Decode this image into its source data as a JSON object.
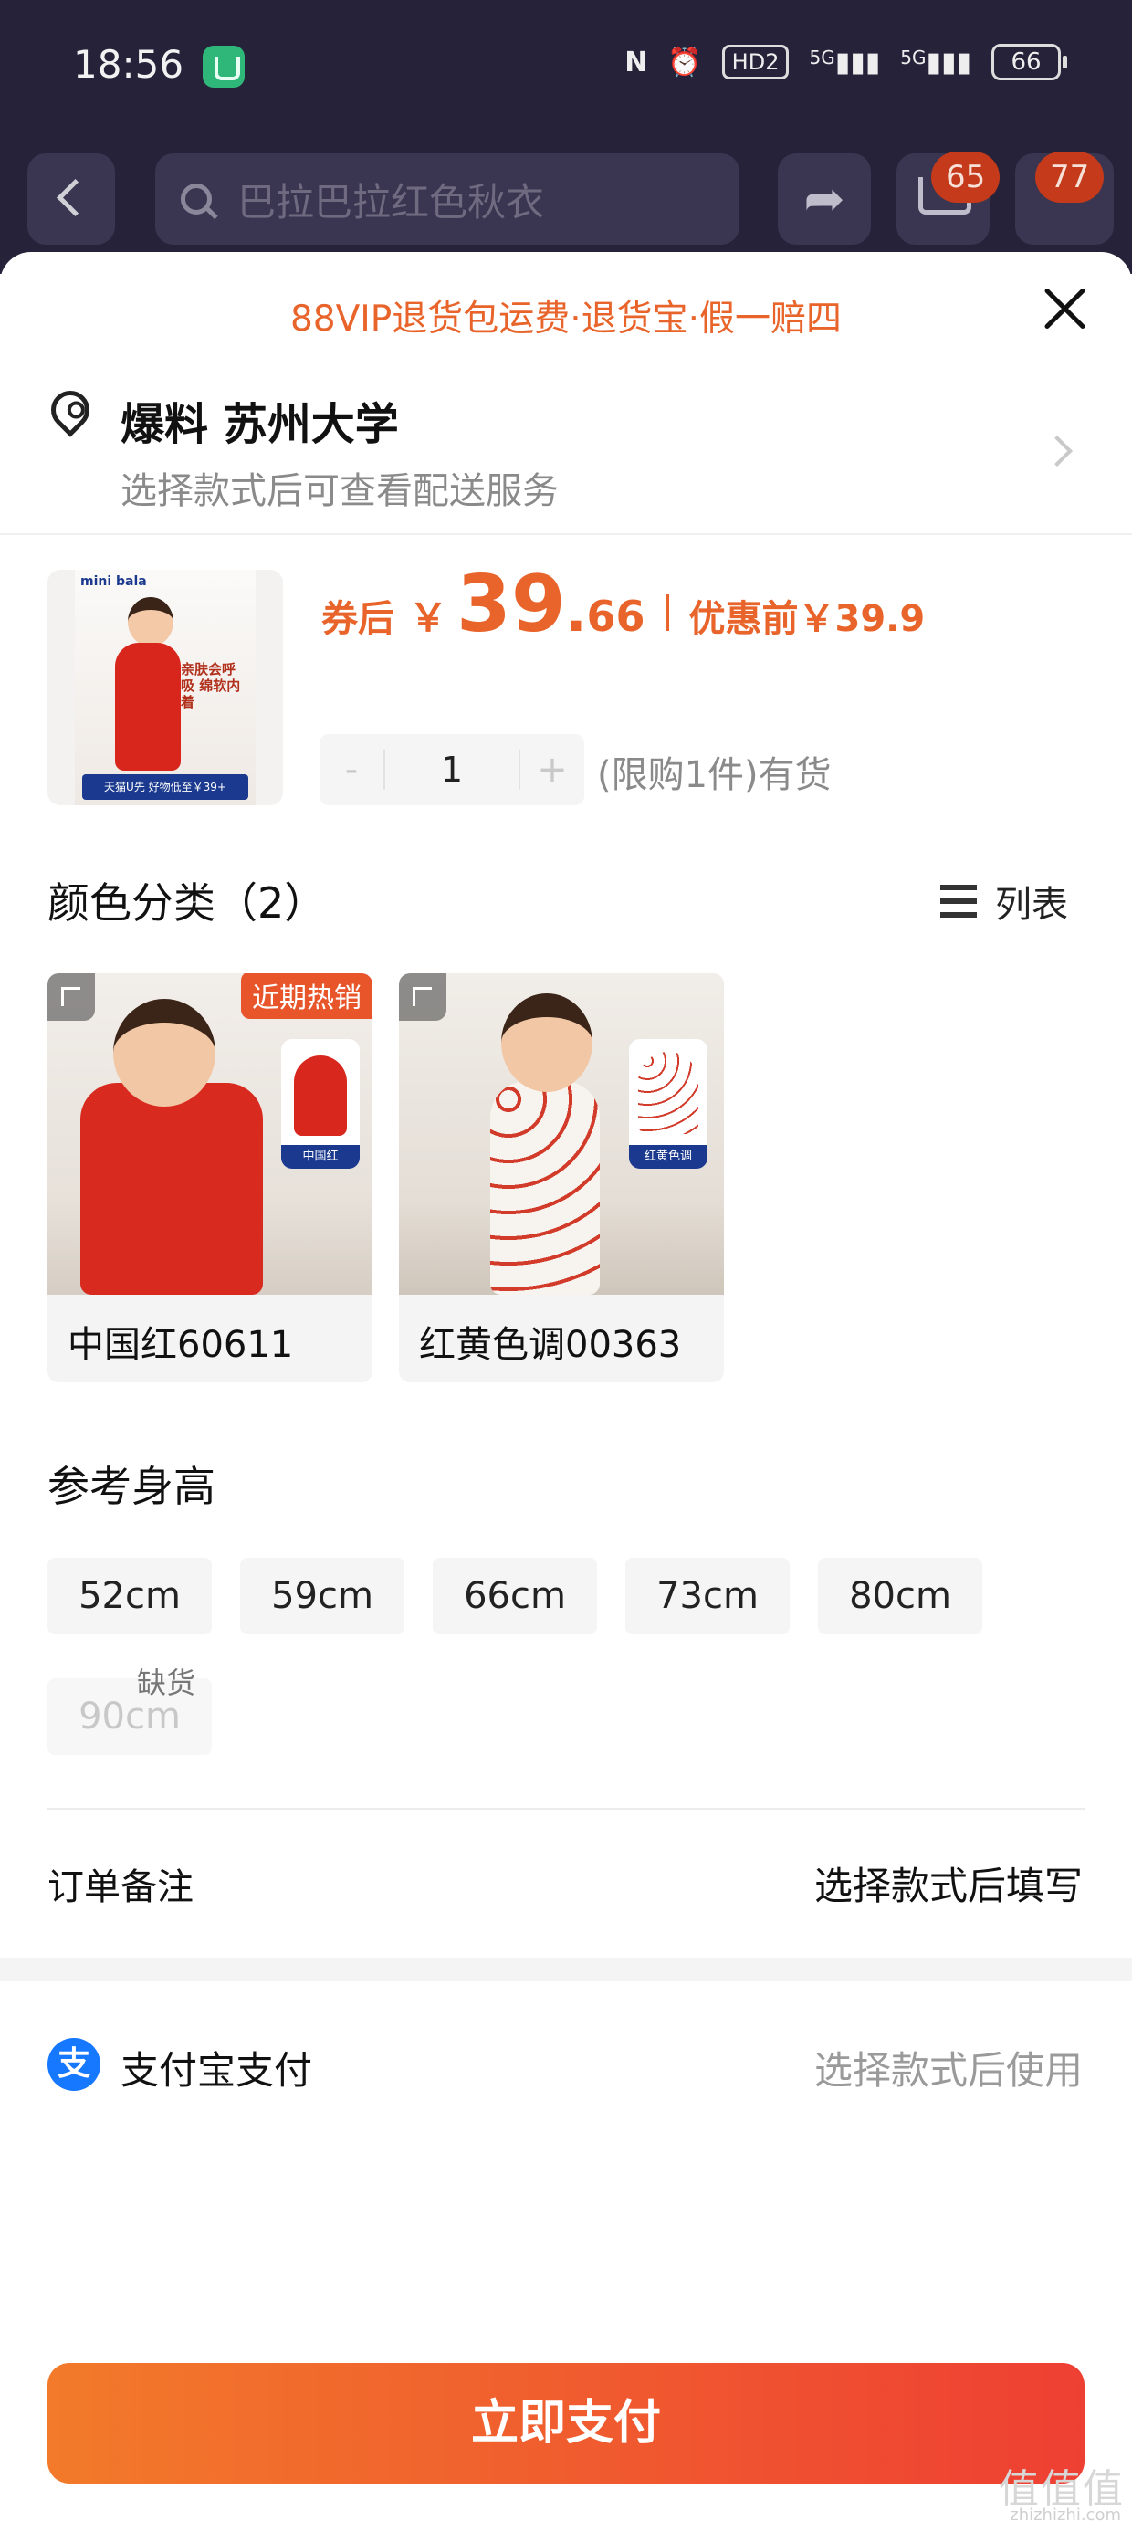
{
  "status_bar": {
    "time": "18:56",
    "nfc": "N",
    "hd": "HD2",
    "signal1": "5G",
    "signal2": "5G",
    "battery": "66"
  },
  "nav": {
    "search_placeholder": "巴拉巴拉红色秋衣",
    "cart_badge": "65",
    "message_badge": "77"
  },
  "sheet": {
    "vip_banner": "88VIP退货包运费·退货宝·假一赔四",
    "address": "爆料 苏州大学",
    "address_sub": "选择款式后可查看配送服务"
  },
  "product": {
    "thumb_logo": "mini bala",
    "thumb_text": "亲肤会呼吸 绵软内着",
    "thumb_footer": "天猫U先 好物低至￥39+",
    "price_label": "券后",
    "currency": "￥",
    "price_int": "39",
    "price_dec": "66",
    "price_before": "优惠前￥39.9",
    "quantity": "1",
    "minus": "-",
    "plus": "+",
    "stock": "(限购1件)有货"
  },
  "colors": {
    "title": "颜色分类（2）",
    "view_toggle": "列表",
    "items": [
      {
        "label": "中国红60611",
        "tag": "近期热销",
        "inset_tag": "中国红"
      },
      {
        "label": "红黄色调00363",
        "tag": "",
        "inset_tag": "红黄色调"
      }
    ]
  },
  "sizes": {
    "title": "参考身高",
    "options": [
      "52cm",
      "59cm",
      "66cm",
      "73cm",
      "80cm"
    ],
    "out_of_stock": "90cm",
    "out_of_stock_tag": "缺货"
  },
  "order_note": {
    "label": "订单备注",
    "value": "选择款式后填写"
  },
  "payment": {
    "icon_char": "支",
    "label": "支付宝支付",
    "value": "选择款式后使用"
  },
  "pay_button": "立即支付",
  "watermark": {
    "text": "值值值",
    "sub": "zhizhizhi.com"
  },
  "accent_colors": {
    "orange": "#e8642a",
    "pay_start": "#f27a2a",
    "pay_end": "#ee3f33",
    "alipay_blue": "#1677ff"
  }
}
